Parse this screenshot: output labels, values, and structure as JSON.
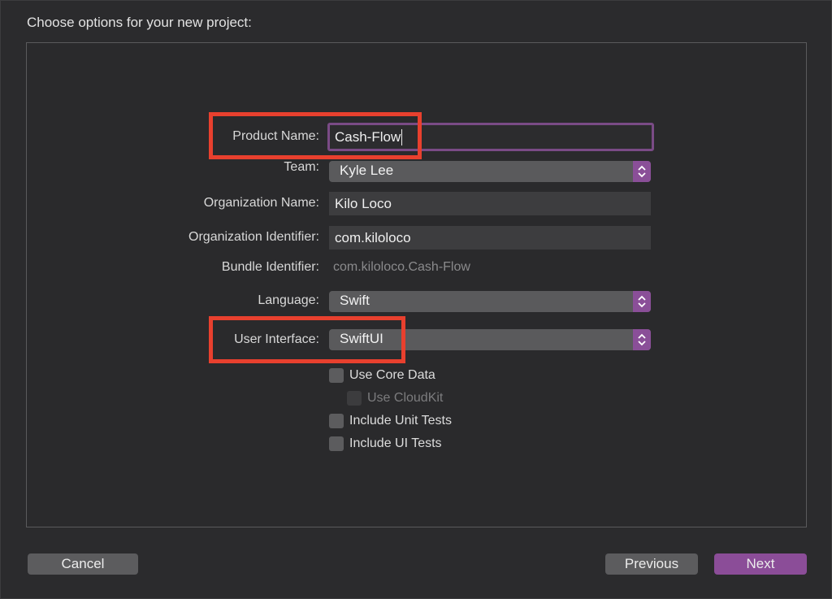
{
  "header": {
    "title": "Choose options for your new project:"
  },
  "form": {
    "product_name": {
      "label": "Product Name:",
      "value": "Cash-Flow"
    },
    "team": {
      "label": "Team:",
      "value": "Kyle Lee"
    },
    "organization_name": {
      "label": "Organization Name:",
      "value": "Kilo Loco"
    },
    "organization_identifier": {
      "label": "Organization Identifier:",
      "value": "com.kiloloco"
    },
    "bundle_identifier": {
      "label": "Bundle Identifier:",
      "value": "com.kiloloco.Cash-Flow"
    },
    "language": {
      "label": "Language:",
      "value": "Swift"
    },
    "user_interface": {
      "label": "User Interface:",
      "value": "SwiftUI"
    }
  },
  "options": {
    "use_core_data": "Use Core Data",
    "use_cloudkit": "Use CloudKit",
    "include_unit_tests": "Include Unit Tests",
    "include_ui_tests": "Include UI Tests"
  },
  "buttons": {
    "cancel": "Cancel",
    "previous": "Previous",
    "next": "Next"
  },
  "colors": {
    "accent": "#8b4d98",
    "highlight": "#e8402e",
    "background": "#2b2b2d"
  }
}
